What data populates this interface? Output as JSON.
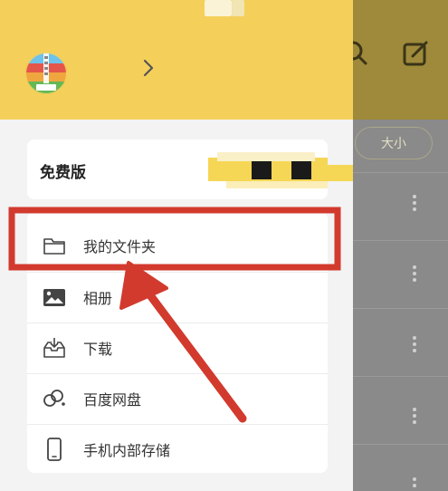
{
  "background": {
    "sort_chip_label": "大小"
  },
  "drawer": {
    "plan": {
      "label": "免费版"
    },
    "menu_items": [
      {
        "label": "我的文件夹",
        "icon": "folder-icon"
      },
      {
        "label": "相册",
        "icon": "image-icon"
      },
      {
        "label": "下载",
        "icon": "download-tray-icon"
      },
      {
        "label": "百度网盘",
        "icon": "cloud-link-icon"
      },
      {
        "label": "手机内部存储",
        "icon": "phone-icon"
      }
    ]
  },
  "colors": {
    "header_yellow": "#f4d05a",
    "highlight_red": "#d23a2e",
    "dim_background": "#8a8a8a"
  }
}
